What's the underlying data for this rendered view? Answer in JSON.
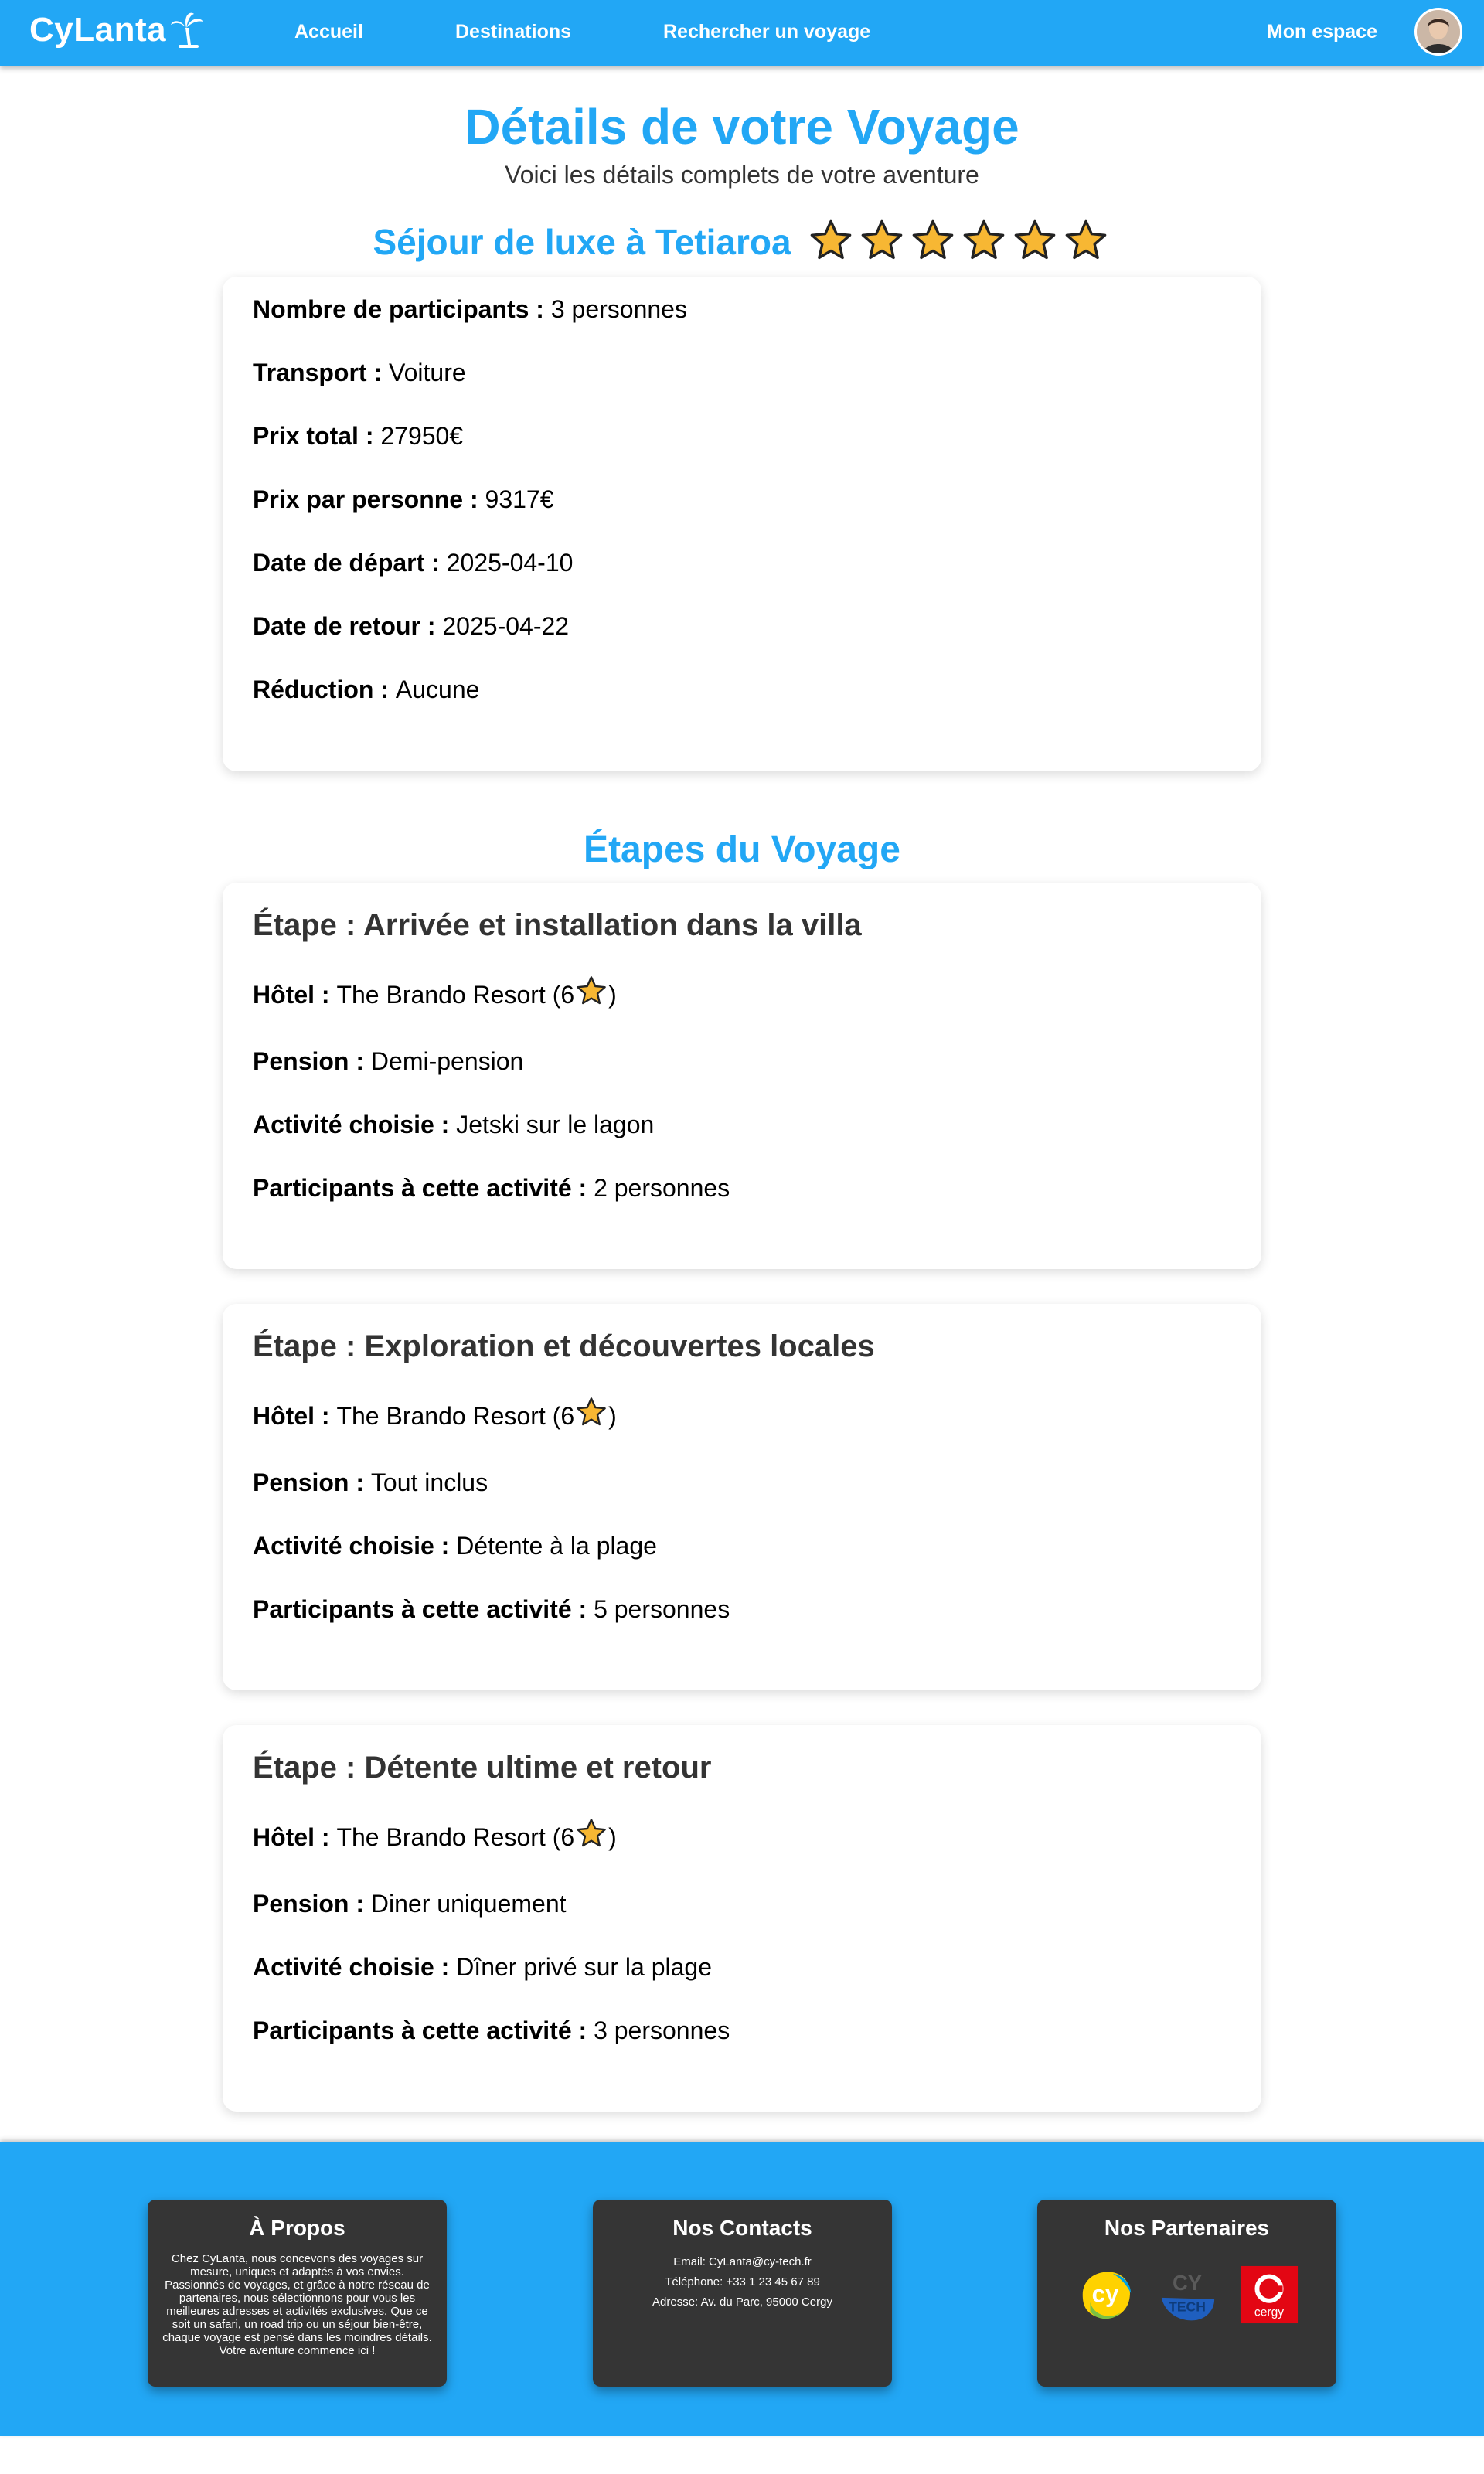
{
  "nav": {
    "brand": "CyLanta",
    "links": [
      "Accueil",
      "Destinations",
      "Rechercher un voyage"
    ],
    "account": "Mon espace"
  },
  "header": {
    "title": "Détails de votre Voyage",
    "subtitle": "Voici les détails complets de votre aventure"
  },
  "trip": {
    "title": "Séjour de luxe à Tetiaroa",
    "rating": 6,
    "details": [
      {
        "label": "Nombre de participants : ",
        "value": "3 personnes"
      },
      {
        "label": "Transport : ",
        "value": "Voiture"
      },
      {
        "label": "Prix total : ",
        "value": "27950€"
      },
      {
        "label": "Prix par personne : ",
        "value": "9317€"
      },
      {
        "label": "Date de départ : ",
        "value": "2025-04-10"
      },
      {
        "label": "Date de retour : ",
        "value": "2025-04-22"
      },
      {
        "label": "Réduction : ",
        "value": "Aucune"
      }
    ]
  },
  "stages_section_title": "Étapes du Voyage",
  "labels": {
    "hotel": "Hôtel : ",
    "pension": "Pension : ",
    "activity": "Activité choisie : ",
    "participants": "Participants à cette activité : "
  },
  "stages": [
    {
      "title": "Étape : Arrivée et installation dans la villa",
      "hotel": "The Brando Resort (6",
      "hotel_close": ")",
      "pension": "Demi-pension",
      "activity": "Jetski sur le lagon",
      "participants": "2 personnes"
    },
    {
      "title": "Étape : Exploration et découvertes locales",
      "hotel": "The Brando Resort (6",
      "hotel_close": ")",
      "pension": "Tout inclus",
      "activity": "Détente à la plage",
      "participants": "5 personnes"
    },
    {
      "title": "Étape : Détente ultime et retour",
      "hotel": "The Brando Resort (6",
      "hotel_close": ")",
      "pension": "Diner uniquement",
      "activity": "Dîner privé sur la plage",
      "participants": "3 personnes"
    }
  ],
  "footer": {
    "about": {
      "title": "À Propos",
      "text": "Chez CyLanta, nous concevons des voyages sur mesure, uniques et adaptés à vos envies. Passionnés de voyages, et grâce à notre réseau de partenaires, nous sélectionnons pour vous les meilleures adresses et activités exclusives. Que ce soit un safari, un road trip ou un séjour bien-être, chaque voyage est pensé dans les moindres détails. Votre aventure commence ici !"
    },
    "contacts": {
      "title": "Nos Contacts",
      "email": "Email: CyLanta@cy-tech.fr",
      "phone": "Téléphone: +33 1 23 45 67 89",
      "address": "Adresse: Av. du Parc, 95000 Cergy"
    },
    "partners": {
      "title": "Nos Partenaires",
      "logos": [
        "cy-logo",
        "cy-tech-logo",
        "cergy-logo"
      ],
      "logo_texts": [
        "cy",
        "CY",
        "TECH",
        "cergy"
      ]
    }
  },
  "colors": {
    "primary": "#22a7f5",
    "star": "#f7b733",
    "footer_box": "#353535"
  }
}
